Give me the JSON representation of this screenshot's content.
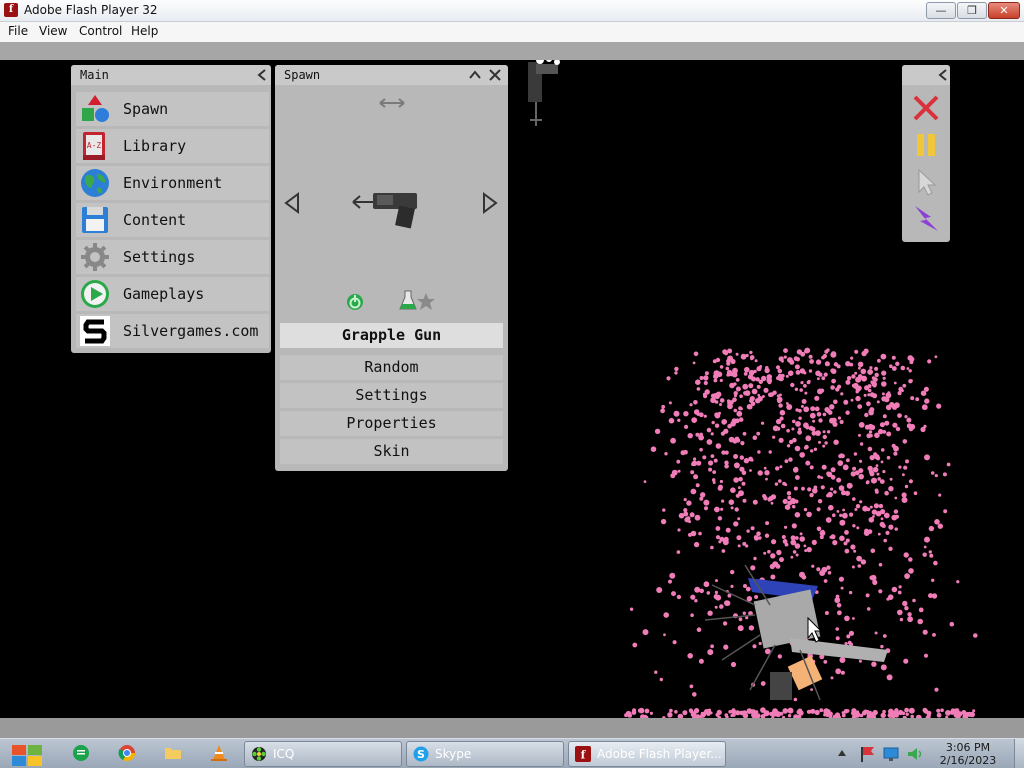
{
  "window": {
    "title": "Adobe Flash Player 32",
    "controls": {
      "minimize": "—",
      "maximize": "❐",
      "close": "✕"
    }
  },
  "menubar": [
    "File",
    "View",
    "Control",
    "Help"
  ],
  "main_panel": {
    "title": "Main",
    "collapse_icon": "chevron-left-icon",
    "items": [
      {
        "label": "Spawn",
        "icon": "shapes-icon"
      },
      {
        "label": "Library",
        "icon": "book-a-z-icon"
      },
      {
        "label": "Environment",
        "icon": "globe-icon"
      },
      {
        "label": "Content",
        "icon": "floppy-disk-icon"
      },
      {
        "label": "Settings",
        "icon": "gear-icon"
      },
      {
        "label": "Gameplays",
        "icon": "play-circle-icon"
      },
      {
        "label": "Silvergames.com",
        "icon": "silvergames-logo-icon"
      }
    ]
  },
  "spawn_panel": {
    "title": "Spawn",
    "selected_item": "Grapple Gun",
    "options": [
      "Random",
      "Settings",
      "Properties",
      "Skin"
    ]
  },
  "tool_panel": {
    "tools": [
      "close-x-icon",
      "pause-icon",
      "pointer-cursor-icon",
      "lightning-icon"
    ]
  },
  "taskbar": {
    "buttons": [
      {
        "label": "ICQ",
        "icon": "icq-flower-icon"
      },
      {
        "label": "Skype",
        "icon": "skype-icon"
      },
      {
        "label": "Adobe Flash Player...",
        "icon": "flash-icon"
      }
    ],
    "clock": {
      "time": "3:06 PM",
      "date": "2/16/2023"
    }
  },
  "colors": {
    "stage": "#000000",
    "panel": "#b8b8b8",
    "particles": "#f07cb8",
    "ragdoll_cap": "#2e43b8"
  }
}
